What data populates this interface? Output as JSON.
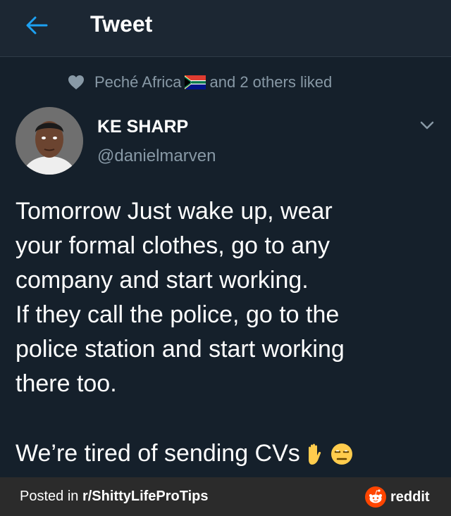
{
  "header": {
    "title": "Tweet",
    "back_icon": "arrow-left-icon"
  },
  "social_context": {
    "icon": "heart-icon",
    "liker_name": "Peché Africa",
    "flag_icon": "south-africa-flag-icon",
    "suffix": "and 2 others liked"
  },
  "tweet": {
    "author_name": "KE SHARP",
    "author_handle": "@danielmarven",
    "menu_icon": "chevron-down-icon",
    "text": "Tomorrow Just wake up, wear\nyour formal clothes, go to any\ncompany and start working.\nIf they call the police, go to the\npolice station and start working\nthere too.",
    "last_line": "We’re tired of sending CVs",
    "emojis": [
      "raised-hand-emoji",
      "unamused-face-emoji"
    ]
  },
  "footer": {
    "prefix": "Posted in ",
    "subreddit": "r/ShittyLifeProTips",
    "brand": "reddit",
    "brand_icon": "reddit-alien-icon"
  },
  "colors": {
    "background": "#15202b",
    "header_bg": "#1c2733",
    "accent": "#1da1f2",
    "muted": "#8899a6",
    "footer_bg": "#2b2b2b",
    "reddit_orange": "#ff4500"
  }
}
